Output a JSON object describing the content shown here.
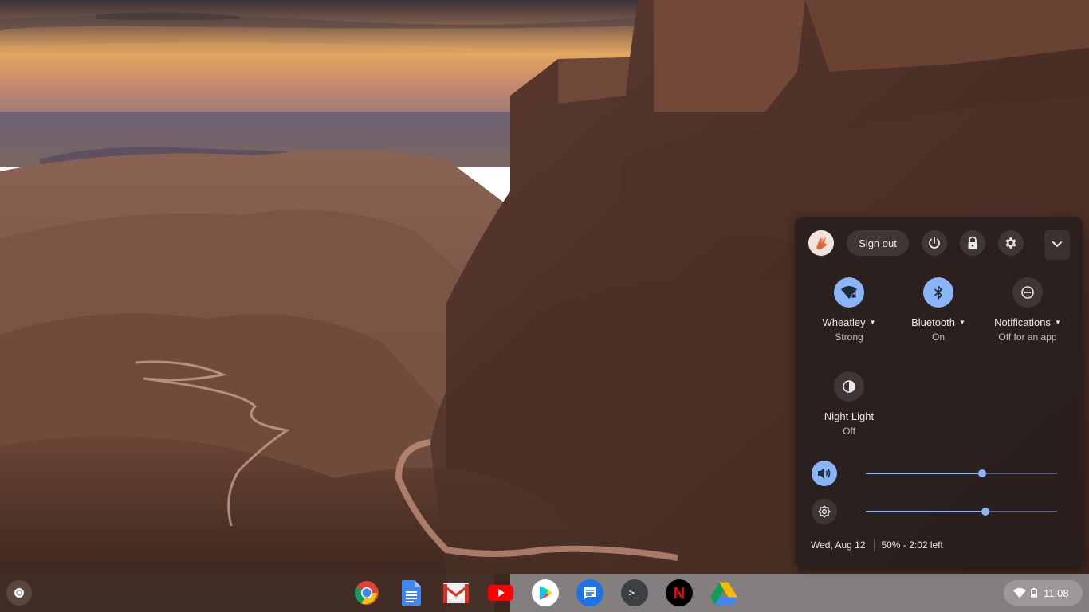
{
  "quick_settings": {
    "sign_out_label": "Sign out",
    "top_icons": [
      "power-icon",
      "lock-icon",
      "gear-icon",
      "chevron-down-icon"
    ],
    "pods": [
      {
        "label": "Wheatley",
        "sublabel": "Strong",
        "icon": "wifi-locked-icon",
        "active": true
      },
      {
        "label": "Bluetooth",
        "sublabel": "On",
        "icon": "bluetooth-icon",
        "active": true
      },
      {
        "label": "Notifications",
        "sublabel": "Off for an app",
        "icon": "do-not-disturb-icon",
        "active": false
      },
      {
        "label": "Night Light",
        "sublabel": "Off",
        "icon": "night-light-icon",
        "active": false
      }
    ],
    "volume": {
      "icon": "volume-icon",
      "level_fraction": 0.61
    },
    "brightness": {
      "icon": "brightness-icon",
      "level_fraction": 0.625
    },
    "date": "Wed, Aug 12",
    "battery_status": "50% - 2:02 left"
  },
  "shelf": {
    "apps": [
      "chrome-icon",
      "google-docs-icon",
      "gmail-icon",
      "youtube-icon",
      "play-store-icon",
      "messages-icon",
      "terminal-icon",
      "netflix-icon",
      "google-drive-icon"
    ],
    "terminal_glyph": ">_",
    "netflix_glyph": "N",
    "time": "11:08"
  },
  "colors": {
    "accent": "#8ab4f8",
    "panel_background": "#281f1e"
  }
}
